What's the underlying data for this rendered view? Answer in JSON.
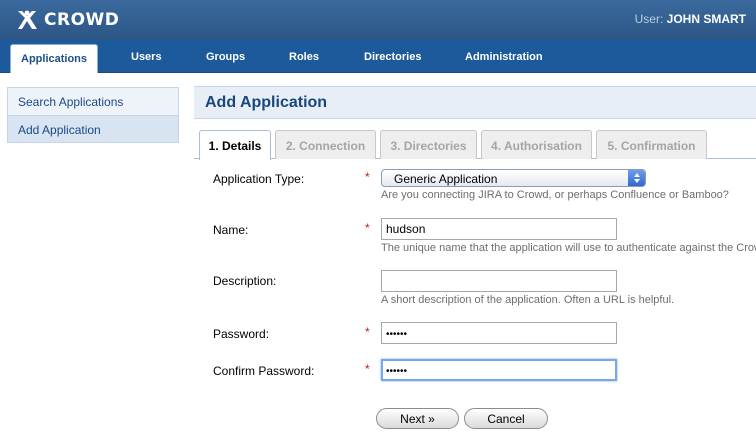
{
  "header": {
    "logo_text": "CROWD",
    "user_label": "User:",
    "user_name": "JOHN SMART"
  },
  "nav": {
    "items": [
      {
        "label": "Applications",
        "active": true
      },
      {
        "label": "Users"
      },
      {
        "label": "Groups"
      },
      {
        "label": "Roles"
      },
      {
        "label": "Directories"
      },
      {
        "label": "Administration"
      }
    ]
  },
  "sidebar": {
    "items": [
      {
        "label": "Search Applications"
      },
      {
        "label": "Add Application",
        "active": true
      }
    ]
  },
  "page": {
    "title": "Add Application"
  },
  "tabs": [
    {
      "label": "1. Details",
      "active": true
    },
    {
      "label": "2. Connection"
    },
    {
      "label": "3. Directories"
    },
    {
      "label": "4. Authorisation"
    },
    {
      "label": "5. Confirmation"
    }
  ],
  "form": {
    "required_marker": "*",
    "app_type": {
      "label": "Application Type:",
      "value": "Generic Application",
      "help": "Are you connecting JIRA to Crowd, or perhaps Confluence or Bamboo?"
    },
    "name": {
      "label": "Name:",
      "value": "hudson",
      "help": "The unique name that the application will use to authenticate against the Crowd"
    },
    "description": {
      "label": "Description:",
      "value": "",
      "help": "A short description of the application. Often a URL is helpful."
    },
    "password": {
      "label": "Password:",
      "value": "••••••"
    },
    "confirm_password": {
      "label": "Confirm Password:",
      "value": "••••••"
    }
  },
  "buttons": {
    "next": "Next »",
    "cancel": "Cancel"
  },
  "colors": {
    "header_bg": "#2c5686",
    "nav_bg": "#1c5a9c",
    "title_color": "#18477f",
    "required": "#d21414"
  }
}
